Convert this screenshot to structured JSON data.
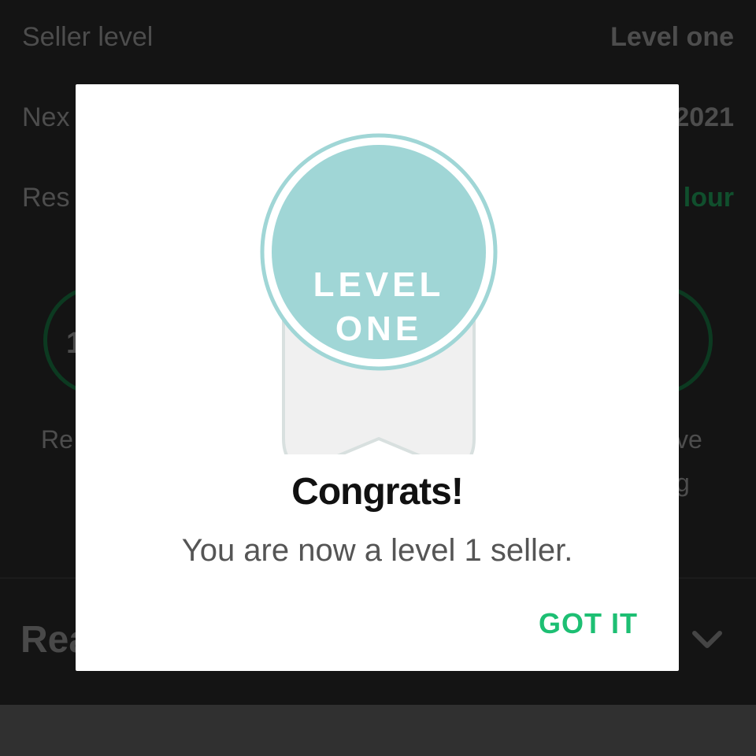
{
  "background": {
    "rows": [
      {
        "label": "Seller level",
        "value": "Level one"
      },
      {
        "label": "Nex",
        "value": "2021"
      },
      {
        "label": "Res",
        "value": "lour"
      }
    ],
    "stats": [
      {
        "number": "1",
        "caption_lines": [
          "Re"
        ]
      },
      {
        "number": "",
        "caption_lines": [
          "ve",
          "g"
        ]
      }
    ],
    "section_title": "Rea",
    "chevron_icon": "chevron-down-icon",
    "accent_color": "#1dbf73"
  },
  "dialog": {
    "badge": {
      "line1": "LEVEL",
      "line2": "ONE",
      "icon": "ribbon-badge-icon",
      "circle_color": "#a0d6d6",
      "ribbon_color": "#f0f0f0"
    },
    "title": "Congrats!",
    "message": "You are now a level 1 seller.",
    "confirm_label": "GOT IT"
  }
}
